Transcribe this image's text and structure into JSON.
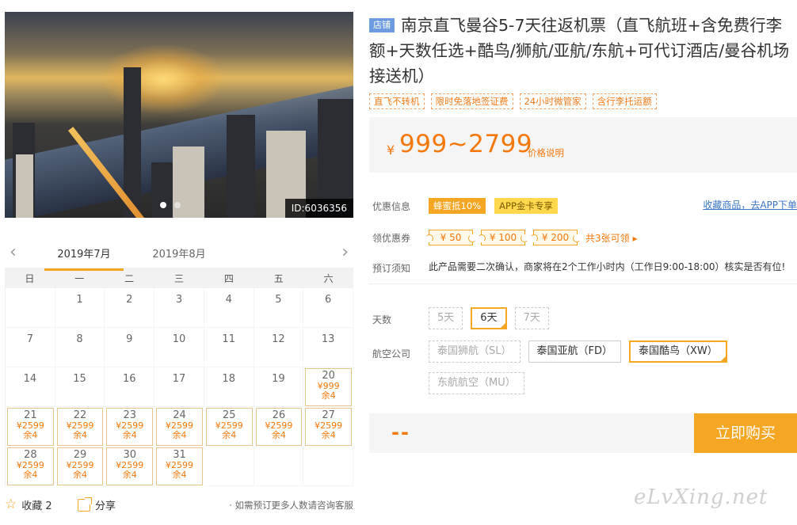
{
  "photo": {
    "id_label": "ID:6036356"
  },
  "calendar": {
    "months": [
      "2019年7月",
      "2019年8月"
    ],
    "weekdays": [
      "日",
      "一",
      "二",
      "三",
      "四",
      "五",
      "六"
    ],
    "rows": [
      [
        {
          "d": ""
        },
        {
          "d": "1"
        },
        {
          "d": "2"
        },
        {
          "d": "3"
        },
        {
          "d": "4"
        },
        {
          "d": "5"
        },
        {
          "d": "6"
        }
      ],
      [
        {
          "d": "7"
        },
        {
          "d": "8"
        },
        {
          "d": "9"
        },
        {
          "d": "10"
        },
        {
          "d": "11"
        },
        {
          "d": "12"
        },
        {
          "d": "13"
        }
      ],
      [
        {
          "d": "14"
        },
        {
          "d": "15"
        },
        {
          "d": "16"
        },
        {
          "d": "17"
        },
        {
          "d": "18"
        },
        {
          "d": "19"
        },
        {
          "d": "20",
          "p": "¥999",
          "s": "余4"
        }
      ],
      [
        {
          "d": "21",
          "p": "¥2599",
          "s": "余4"
        },
        {
          "d": "22",
          "p": "¥2599",
          "s": "余4"
        },
        {
          "d": "23",
          "p": "¥2599",
          "s": "余4"
        },
        {
          "d": "24",
          "p": "¥2599",
          "s": "余4"
        },
        {
          "d": "25",
          "p": "¥2599",
          "s": "余4"
        },
        {
          "d": "26",
          "p": "¥2599",
          "s": "余4"
        },
        {
          "d": "27",
          "p": "¥2599",
          "s": "余4"
        }
      ],
      [
        {
          "d": "28",
          "p": "¥2599",
          "s": "余4"
        },
        {
          "d": "29",
          "p": "¥2599",
          "s": "余4"
        },
        {
          "d": "30",
          "p": "¥2599",
          "s": "余4"
        },
        {
          "d": "31",
          "p": "¥2599",
          "s": "余4"
        },
        {
          "d": ""
        },
        {
          "d": ""
        },
        {
          "d": ""
        }
      ]
    ]
  },
  "footer": {
    "fav_label": "收藏 2",
    "share_label": "分享",
    "note": "· 如需预订更多人数请咨询客服"
  },
  "product": {
    "shop_badge": "店铺",
    "title": "南京直飞曼谷5-7天往返机票（直飞航班+含免费行李额+天数任选+酷鸟/狮航/亚航/东航+可代订酒店/曼谷机场接送机）",
    "tags": [
      "直飞不转机",
      "限时免落地签证费",
      "24小时微管家",
      "含行李托运额"
    ],
    "currency": "¥",
    "price_range": "999~2799",
    "price_desc": "价格说明"
  },
  "promo": {
    "label": "优惠信息",
    "tags": [
      "蜂蜜抵10%",
      "APP金卡专享"
    ],
    "fav_link": "收藏商品，去APP下单"
  },
  "coupons": {
    "label": "领优惠券",
    "items": [
      "¥ 50",
      "¥ 100",
      "¥ 200"
    ],
    "more": "共3张可领 ▸"
  },
  "booking": {
    "label": "预订须知",
    "text": "此产品需要二次确认，商家将在2个工作小时内（工作日9:00-18:00）核实是否有位!"
  },
  "days": {
    "label": "天数",
    "options": [
      "5天",
      "6天",
      "7天"
    ]
  },
  "airline": {
    "label": "航空公司",
    "options": [
      "泰国狮航（SL）",
      "泰国亚航（FD）",
      "泰国酷鸟（XW）",
      "东航航空（MU）"
    ]
  },
  "buy": {
    "total": "--",
    "button": "立即购买"
  },
  "watermark": "eLvXing.net",
  "colors": {
    "accent": "#f5a623",
    "price": "#f5780a",
    "link": "#3a76c4",
    "badge": "#6d9be0"
  }
}
